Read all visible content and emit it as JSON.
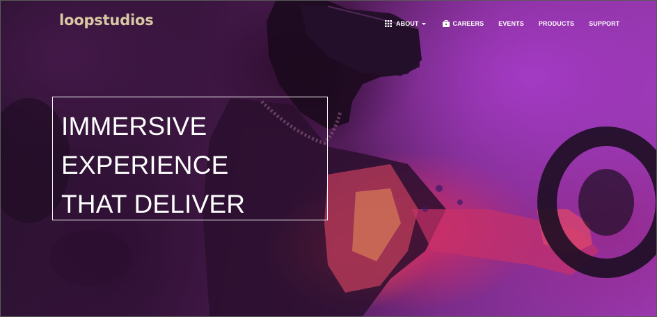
{
  "brand": {
    "logo_text": "loopstudios"
  },
  "nav": {
    "about": {
      "label": "ABOUT",
      "icon": "grid-icon"
    },
    "careers": {
      "label": "CAREERS",
      "icon": "briefcase-icon"
    },
    "events": {
      "label": "EVENTS"
    },
    "products": {
      "label": "PRODUCTS"
    },
    "support": {
      "label": "SUPPORT"
    }
  },
  "hero": {
    "headline_lines": [
      "IMMERSIVE",
      "EXPERIENCE",
      "THAT DELIVER"
    ],
    "image": "person wearing VR headset holding a steering wheel"
  },
  "colors": {
    "logo": "#d9c8a3",
    "text": "#ffffff",
    "overlay_purple": "#7b2c8a",
    "overlay_magenta": "#e12d5f"
  }
}
